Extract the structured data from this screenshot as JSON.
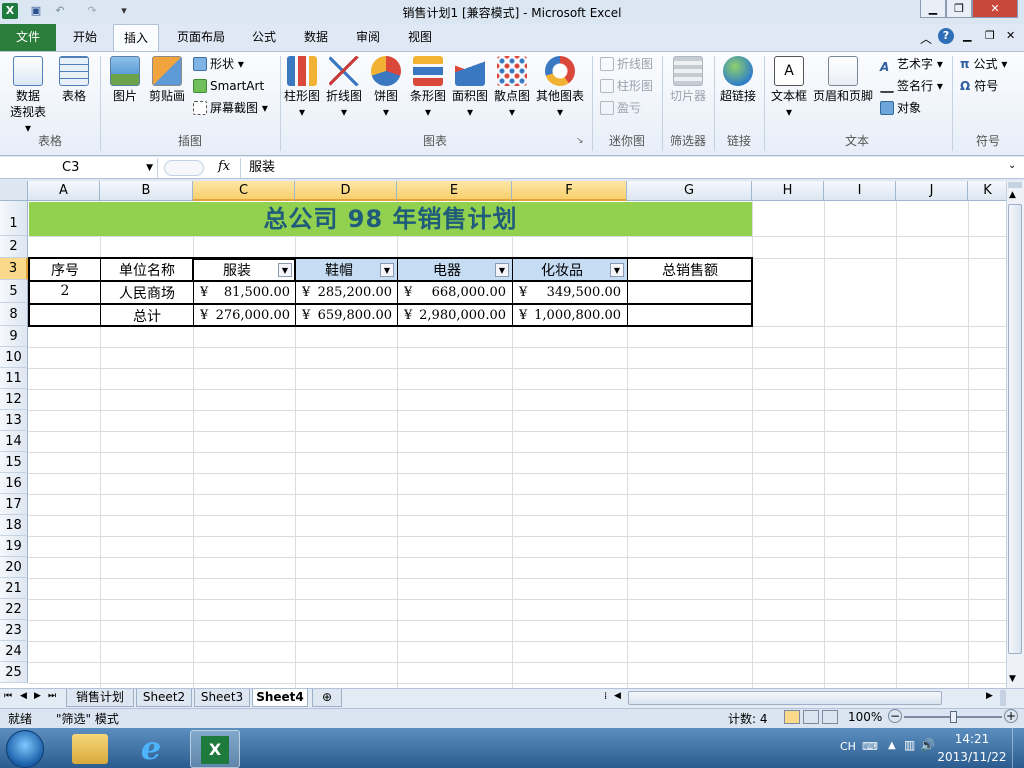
{
  "window": {
    "title": "销售计划1 [兼容模式] - Microsoft Excel"
  },
  "tabs": [
    "文件",
    "开始",
    "插入",
    "页面布局",
    "公式",
    "数据",
    "审阅",
    "视图"
  ],
  "ribbon": {
    "groups": {
      "tables": "表格",
      "illustrations": "插图",
      "charts": "图表",
      "sparklines": "迷你图",
      "filter": "筛选器",
      "links": "链接",
      "text": "文本",
      "symbols": "符号"
    },
    "pivot_line1": "数据",
    "pivot_line2": "透视表",
    "table": "表格",
    "picture": "图片",
    "clipart": "剪贴画",
    "shapes": "形状",
    "smartart": "SmartArt",
    "screenshot": "屏幕截图",
    "charts": [
      "柱形图",
      "折线图",
      "饼图",
      "条形图",
      "面积图",
      "散点图",
      "其他图表"
    ],
    "spark": [
      "折线图",
      "柱形图",
      "盈亏"
    ],
    "slicer": "切片器",
    "hyperlink": "超链接",
    "textbox": "文本框",
    "headerfooter": "页眉和页脚",
    "wordart": "艺术字",
    "signature": "签名行",
    "object": "对象",
    "equation": "公式",
    "symbol": "符号"
  },
  "formula_bar": {
    "name_box": "C3",
    "fx": "fx",
    "content": "服装"
  },
  "columns": [
    "A",
    "B",
    "C",
    "D",
    "E",
    "F",
    "G",
    "H",
    "I",
    "J",
    "K"
  ],
  "rows": [
    "1",
    "2",
    "3",
    "5",
    "8",
    "9",
    "10",
    "11",
    "12",
    "13",
    "14",
    "15",
    "16",
    "17",
    "18",
    "19",
    "20",
    "21",
    "22",
    "23",
    "24",
    "25"
  ],
  "sheet": {
    "title": "总公司  98  年销售计划",
    "headers": [
      "序号",
      "单位名称",
      "服装",
      "鞋帽",
      "电器",
      "化妆品",
      "总销售额"
    ],
    "row5": {
      "seq": "2",
      "unit": "人民商场",
      "c": "81,500.00",
      "d": "285,200.00",
      "e": "668,000.00",
      "f": "349,500.00"
    },
    "row8": {
      "unit": "总计",
      "c": "276,000.00",
      "d": "659,800.00",
      "e": "2,980,000.00",
      "f": "1,000,800.00"
    },
    "currency": "¥"
  },
  "sheet_tabs": [
    "销售计划",
    "Sheet2",
    "Sheet3",
    "Sheet4"
  ],
  "status": {
    "ready": "就绪",
    "mode": "\"筛选\" 模式",
    "count": "计数: 4",
    "zoom": "100%"
  },
  "taskbar": {
    "lang": "CH",
    "time": "14:21",
    "date": "2013/11/22"
  },
  "colors": {
    "title_fill": "#92d050",
    "title_text": "#1f5b7a",
    "header_fill": "#c5dcf3",
    "file_tab": "#2b7d3a"
  }
}
